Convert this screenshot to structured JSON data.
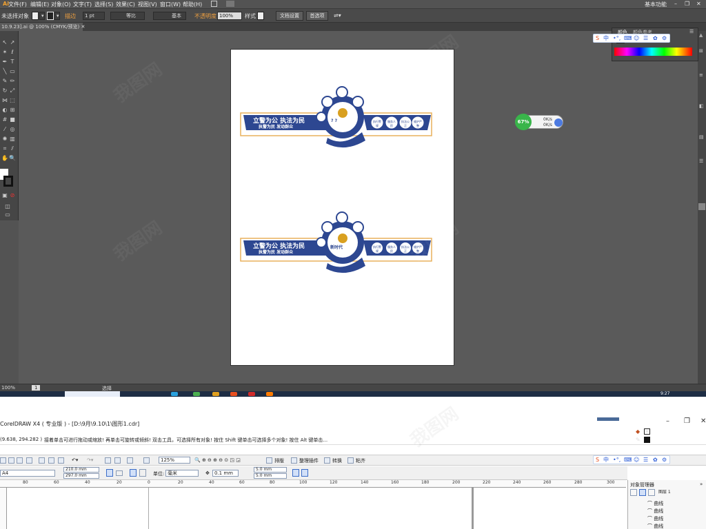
{
  "illustrator": {
    "menus": [
      "文件(F)",
      "编辑(E)",
      "对象(O)",
      "文字(T)",
      "选择(S)",
      "效果(C)",
      "视图(V)",
      "窗口(W)",
      "帮助(H)"
    ],
    "workspace": "基本功能",
    "control_bar": {
      "no_selection": "未选择对象",
      "stroke_label": "描边",
      "stroke_weight": "1 pt",
      "profile_uniform": "等比",
      "brush_basic": "基本",
      "opacity_label": "不透明度",
      "opacity_value": "100%",
      "style_label": "样式",
      "doc_setup_button": "文档设置",
      "preferences_button": "首选项"
    },
    "doc_tab": "10.9.23].ai @ 100% (CMYK/预览)",
    "status": {
      "zoom": "100%",
      "page": "1",
      "tool": "选择"
    },
    "color_panel": {
      "tab_color": "颜色",
      "tab_ref": "颜色参考"
    },
    "speed_widget": {
      "percent": "67%",
      "up": "0K/s",
      "down": "0K/s"
    },
    "clock": "9:27",
    "ime": [
      "中",
      "•°,",
      "☰",
      "☐"
    ]
  },
  "artwork": {
    "banner1": {
      "left_line1": "立警为公 执法为民",
      "left_line2": "执警为民  发动群众",
      "center_top": "? ?",
      "right_items": [
        "执行警规",
        "服务人民",
        "执法公正",
        "维护严整"
      ]
    },
    "banner2": {
      "left_line1": "立警为公 执法为民",
      "left_line2": "执警为民  发动群众",
      "center_top": "新时代",
      "right_items": [
        "执行警规",
        "服务人民",
        "执法公正",
        "维护严整"
      ]
    }
  },
  "coreldraw": {
    "title": "CorelDRAW X4 ( 专业版 ) - [D:\\9月\\9.10\\1\\图形1.cdr]",
    "coords": "(9.638, 294.282 )",
    "hint": "接着单击可进行拖动或缩放! 再单击可旋转或倾斜! 双击工具，可选择所有对象! 按住 Shift 键单击可选择多个对象! 按住 Alt 键单击...",
    "zoom": "125%",
    "buttons": [
      "排版",
      "整理插件",
      "转换",
      "粘齐"
    ],
    "page_size": "A4",
    "width": "210.0 mm",
    "height": "297.0 mm",
    "units_label": "单位:",
    "units_value": "毫米",
    "nudge": "0.1 mm",
    "dup_x": "5.0 mm",
    "dup_y": "5.0 mm",
    "ruler_numbers": [
      "80",
      "60",
      "40",
      "20",
      "0",
      "20",
      "40",
      "60",
      "80",
      "100",
      "120",
      "140",
      "160",
      "180",
      "200",
      "220",
      "240",
      "260",
      "280",
      "300"
    ],
    "object_manager": {
      "title": "对象管理器",
      "layer": "图层 1",
      "items": [
        "曲线",
        "曲线",
        "曲线",
        "曲线"
      ]
    }
  },
  "watermark": "我图网"
}
